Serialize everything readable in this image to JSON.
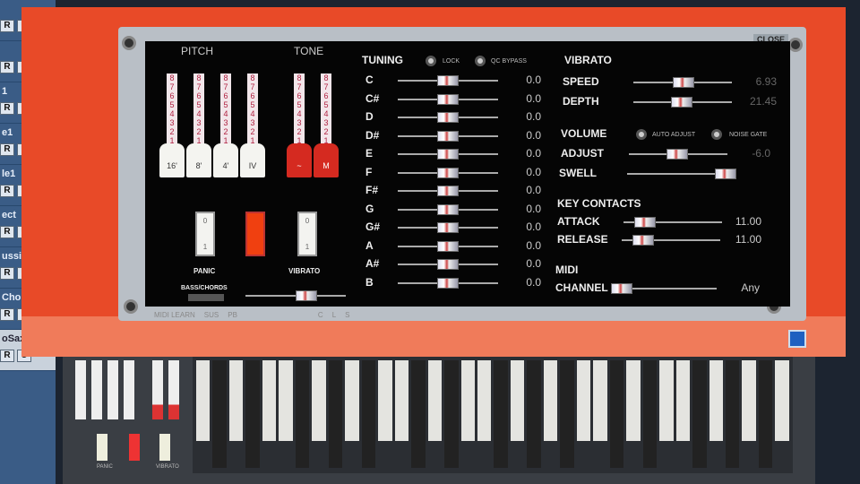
{
  "sidebar": {
    "tracks": [
      "",
      "",
      "1",
      "e1",
      "le1",
      "ect",
      "ussions (",
      "Choir",
      "oSax"
    ],
    "r_label": "R",
    "u_label": "U"
  },
  "dialog": {
    "close": "CLOSE",
    "footer": [
      "MIDI LEARN",
      "SUS",
      "PB",
      "C",
      "L",
      "S"
    ]
  },
  "pitch": {
    "title": "PITCH",
    "drawbars": [
      "16'",
      "8'",
      "4'",
      "IV"
    ]
  },
  "tone": {
    "title": "TONE",
    "drawbars": [
      "~",
      "M"
    ]
  },
  "drawbar_numbers": [
    "8",
    "7",
    "6",
    "5",
    "4",
    "3",
    "2",
    "1"
  ],
  "switches": {
    "panic": "PANIC",
    "vibrato": "VIBRATO",
    "bass_chords": "BASS/CHORDS",
    "on": "0",
    "off": "1"
  },
  "tuning": {
    "title": "TUNING",
    "lock": "LOCK",
    "qc_bypass": "QC BYPASS",
    "notes": [
      {
        "n": "C",
        "v": "0.0"
      },
      {
        "n": "C#",
        "v": "0.0"
      },
      {
        "n": "D",
        "v": "0.0"
      },
      {
        "n": "D#",
        "v": "0.0"
      },
      {
        "n": "E",
        "v": "0.0"
      },
      {
        "n": "F",
        "v": "0.0"
      },
      {
        "n": "F#",
        "v": "0.0"
      },
      {
        "n": "G",
        "v": "0.0"
      },
      {
        "n": "G#",
        "v": "0.0"
      },
      {
        "n": "A",
        "v": "0.0"
      },
      {
        "n": "A#",
        "v": "0.0"
      },
      {
        "n": "B",
        "v": "0.0"
      }
    ]
  },
  "vibrato": {
    "title": "VIBRATO",
    "speed": "SPEED",
    "speed_val": "6.93",
    "depth": "DEPTH",
    "depth_val": "21.45"
  },
  "volume": {
    "title": "VOLUME",
    "auto_adjust": "AUTO ADJUST",
    "noise_gate": "NOISE GATE",
    "adjust": "ADJUST",
    "adjust_val": "-6.0",
    "swell": "SWELL"
  },
  "key_contacts": {
    "title": "KEY CONTACTS",
    "attack": "ATTACK",
    "attack_val": "11.00",
    "release": "RELEASE",
    "release_val": "11.00"
  },
  "midi": {
    "title": "MIDI",
    "channel": "CHANNEL",
    "channel_val": "Any"
  },
  "mini": {
    "panic": "PANIC",
    "vibrato": "VIBRATO"
  }
}
